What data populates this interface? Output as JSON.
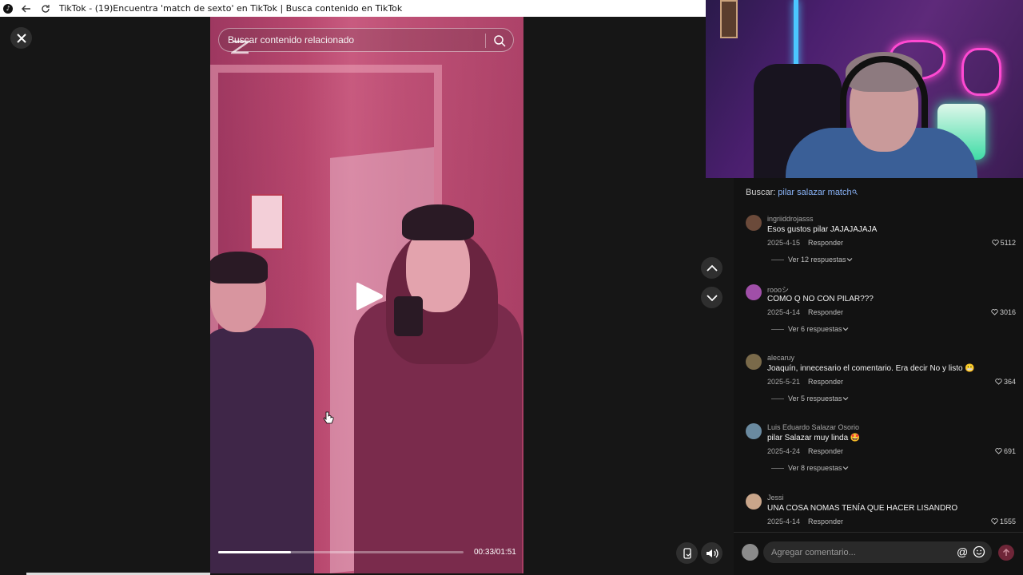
{
  "window": {
    "title": "TikTok - (19)Encuentra 'match de sexto' en TikTok | Busca contenido en TikTok"
  },
  "video": {
    "search_placeholder": "Buscar contenido relacionado",
    "time": "00:33/01:51",
    "progress_fraction": 0.297
  },
  "colors": {
    "accent_send": "#6f2638",
    "link_blue": "#8ab4f8"
  },
  "search": {
    "prefix": "Buscar:",
    "query": "pilar salazar match"
  },
  "reply_label": "Responder",
  "comments": [
    {
      "username": "ingriiddrojasss",
      "text": "Esos gustos pilar JAJAJAJAJA",
      "date": "2025-4-15",
      "likes": "5112",
      "view_replies": "Ver 12 respuestas",
      "avatar_color": "#6b4a3a"
    },
    {
      "username": "roooシ",
      "text": "COMO Q NO CON PILAR???",
      "date": "2025-4-14",
      "likes": "3016",
      "view_replies": "Ver 6 respuestas",
      "avatar_color": "#a04fa8"
    },
    {
      "username": "alecaruy",
      "text": "Joaquín, innecesario el comentario. Era decir No y listo 😬",
      "date": "2025-5-21",
      "likes": "364",
      "view_replies": "Ver 5 respuestas",
      "avatar_color": "#7a6a4a"
    },
    {
      "username": "Luis Eduardo Salazar Osorio",
      "text": "pilar Salazar muy linda 🤩",
      "date": "2025-4-24",
      "likes": "691",
      "view_replies": "Ver 8 respuestas",
      "avatar_color": "#6a8aa0"
    },
    {
      "username": "Jessi",
      "text": "UNA COSA NOMAS TENÍA QUE HACER LISANDRO",
      "date": "2025-4-14",
      "likes": "1555",
      "view_replies": "",
      "avatar_color": "#c9a58a"
    }
  ],
  "comment_input": {
    "placeholder": "Agregar comentario..."
  },
  "icons": {
    "close": "close-icon",
    "search": "search-icon",
    "play": "play-icon",
    "up": "chevron-up-icon",
    "down": "chevron-down-icon",
    "mobile": "mobile-icon",
    "volume": "volume-icon",
    "heart": "heart-icon",
    "at": "at-icon",
    "emoji": "emoji-icon",
    "send": "send-arrow-icon"
  }
}
